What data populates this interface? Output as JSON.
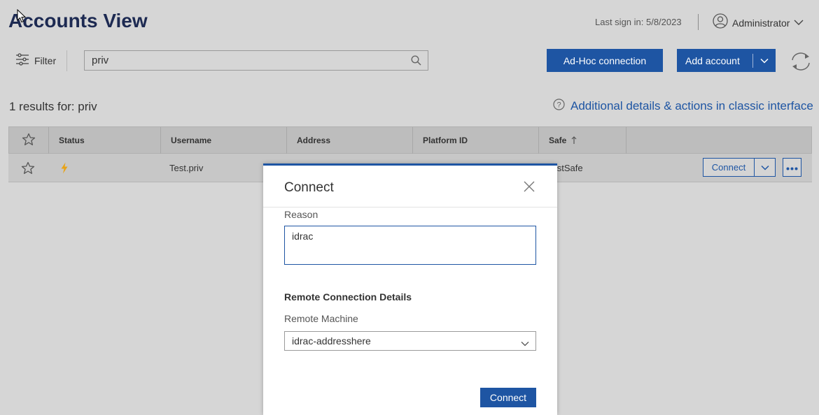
{
  "header": {
    "title": "Accounts View",
    "last_sign_in": "Last sign in: 5/8/2023",
    "user": "Administrator"
  },
  "toolbar": {
    "filter_label": "Filter",
    "search_value": "priv",
    "adhoc_label": "Ad-Hoc connection",
    "add_account_label": "Add account"
  },
  "results": {
    "summary": "1 results  for: priv",
    "classic_link": "Additional details & actions in classic interface"
  },
  "table": {
    "columns": [
      "Status",
      "Username",
      "Address",
      "Platform ID",
      "Safe"
    ],
    "sort_column": "Safe",
    "sort_direction": "ascending",
    "rows": [
      {
        "username": "Test.priv",
        "safe": "TestSafe",
        "connect_label": "Connect"
      }
    ]
  },
  "modal": {
    "title": "Connect",
    "reason_label": "Reason",
    "reason_value": "idrac",
    "section_title": "Remote Connection Details",
    "machine_label": "Remote Machine",
    "machine_value": "idrac-addresshere",
    "connect_button": "Connect"
  },
  "colors": {
    "accent": "#1e55a3",
    "title": "#1d2a52",
    "status_icon": "#e8a317"
  },
  "icons": [
    "user-icon",
    "chevron-down-icon",
    "filter-icon",
    "search-icon",
    "refresh-icon",
    "help-icon",
    "star-icon",
    "lightning-icon",
    "sort-up-icon",
    "more-icon",
    "close-icon"
  ]
}
